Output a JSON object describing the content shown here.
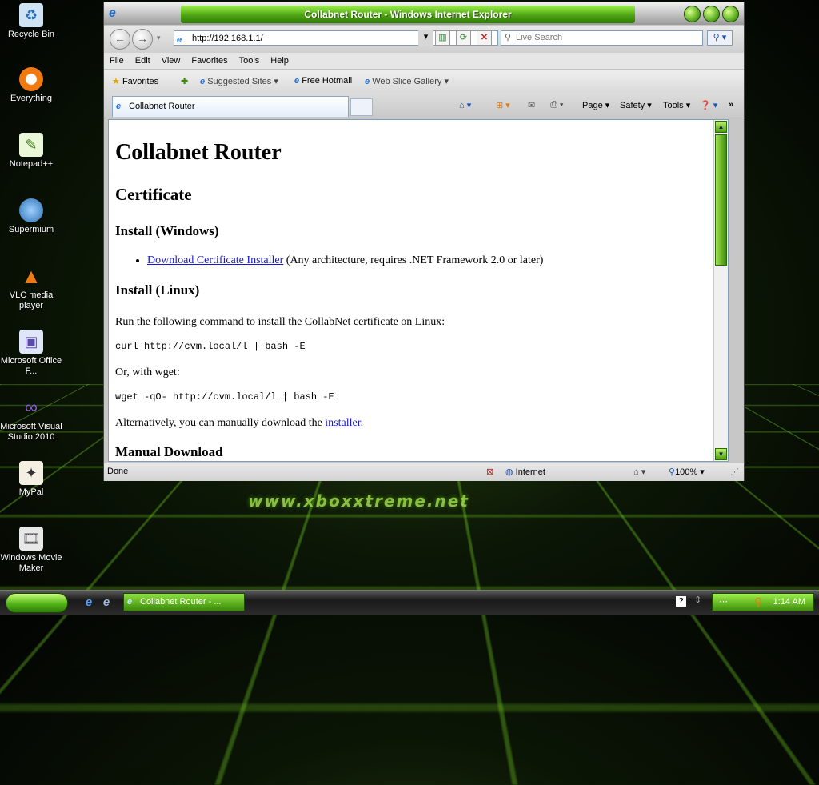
{
  "desktop": {
    "watermark": "www.xboxxtreme.net",
    "icons": [
      {
        "label": "Recycle Bin",
        "icon": "recycle-bin-icon"
      },
      {
        "label": "Everything",
        "icon": "everything-icon"
      },
      {
        "label": "Notepad++",
        "icon": "notepadpp-icon"
      },
      {
        "label": "Supermium",
        "icon": "supermium-icon"
      },
      {
        "label": "VLC media player",
        "icon": "vlc-icon"
      },
      {
        "label": "Microsoft Office F...",
        "icon": "office-icon"
      },
      {
        "label": "Microsoft Visual Studio 2010",
        "icon": "visual-studio-icon"
      },
      {
        "label": "MyPal",
        "icon": "mypal-icon"
      },
      {
        "label": "Windows Movie Maker",
        "icon": "movie-maker-icon"
      }
    ]
  },
  "window": {
    "title": "Collabnet Router - Windows Internet Explorer",
    "address": "http://192.168.1.1/",
    "search_placeholder": "Live Search",
    "menu": [
      "File",
      "Edit",
      "View",
      "Favorites",
      "Tools",
      "Help"
    ],
    "favorites": {
      "label": "Favorites",
      "items": [
        "Suggested Sites ▾",
        "Free Hotmail",
        "Web Slice Gallery ▾"
      ]
    },
    "tab_title": "Collabnet Router",
    "commands": [
      "Page ▾",
      "Safety ▾",
      "Tools ▾"
    ],
    "status": {
      "text": "Done",
      "zone": "Internet",
      "zoom": "100%"
    }
  },
  "page": {
    "h1": "Collabnet Router",
    "h2": "Certificate",
    "install_windows": "Install (Windows)",
    "windows_link": "Download Certificate Installer",
    "windows_note": " (Any architecture, requires .NET Framework 2.0 or later)",
    "install_linux": "Install (Linux)",
    "linux_intro": "Run the following command to install the CollabNet certificate on Linux:",
    "cmd_curl": "curl http://cvm.local/l | bash -E",
    "or_wget": "Or, with wget:",
    "cmd_wget": "wget -qO- http://cvm.local/l | bash -E",
    "alt_prefix": "Alternatively, you can manually download the ",
    "alt_link": "installer",
    "alt_suffix": ".",
    "cut_heading": "Manual Download"
  },
  "taskbar": {
    "task_label": "Collabnet Router - ...",
    "clock": "1:14 AM"
  }
}
